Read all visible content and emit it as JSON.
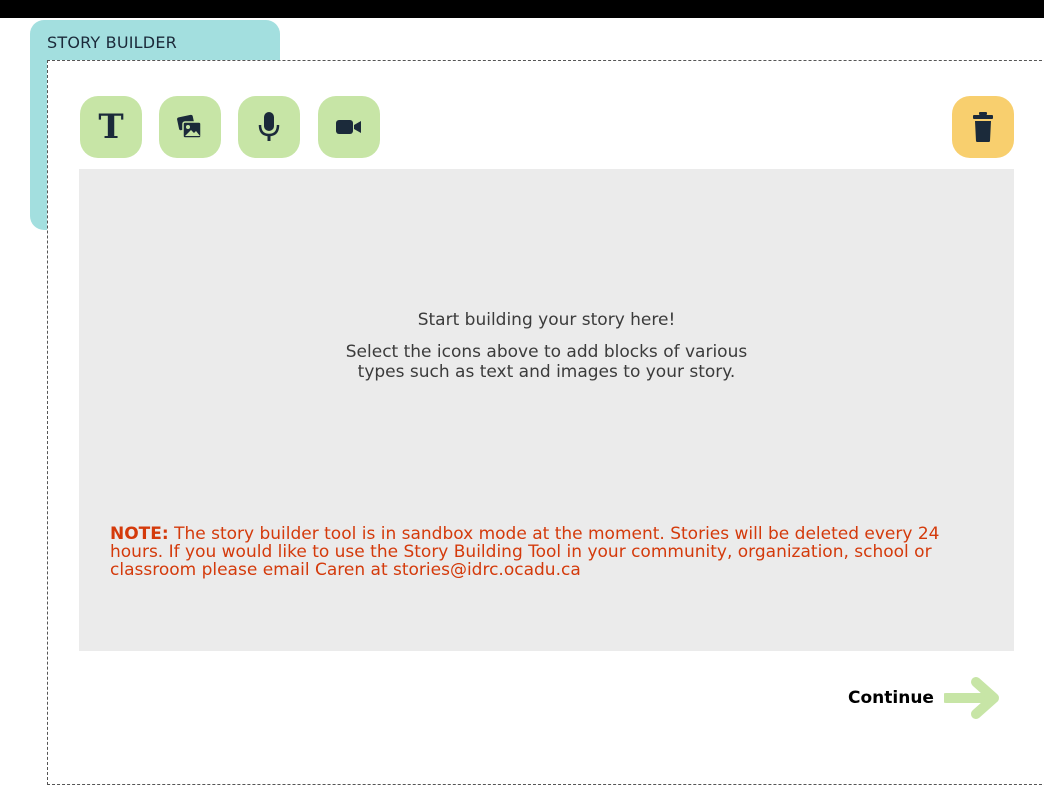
{
  "header": {
    "tab_label": "STORY BUILDER"
  },
  "toolbar": {
    "tools": [
      {
        "name": "text",
        "icon": "text-T-icon",
        "glyph": "T"
      },
      {
        "name": "image",
        "icon": "image-icon"
      },
      {
        "name": "audio",
        "icon": "microphone-icon"
      },
      {
        "name": "video",
        "icon": "video-camera-icon"
      }
    ],
    "delete_icon": "trash-icon"
  },
  "canvas": {
    "empty_title": "Start building your story here!",
    "empty_description": "Select the icons above to add blocks of various types such as text and images to your story.",
    "note_label": "NOTE:",
    "note_text": " The story builder tool is in sandbox mode at the moment. Stories will be deleted every 24 hours. If you would like to use the Story Building Tool in your community, organization, school or classroom please email Caren at stories@idrc.ocadu.ca"
  },
  "footer": {
    "continue_label": "Continue",
    "continue_icon": "arrow-right-icon"
  },
  "colors": {
    "tab": "#a3dfdf",
    "tool_bg": "#c7e5a6",
    "trash_bg": "#f8cf6e",
    "canvas_bg": "#ebebeb",
    "note": "#d43a0b",
    "arrow": "#c7e5a6"
  }
}
